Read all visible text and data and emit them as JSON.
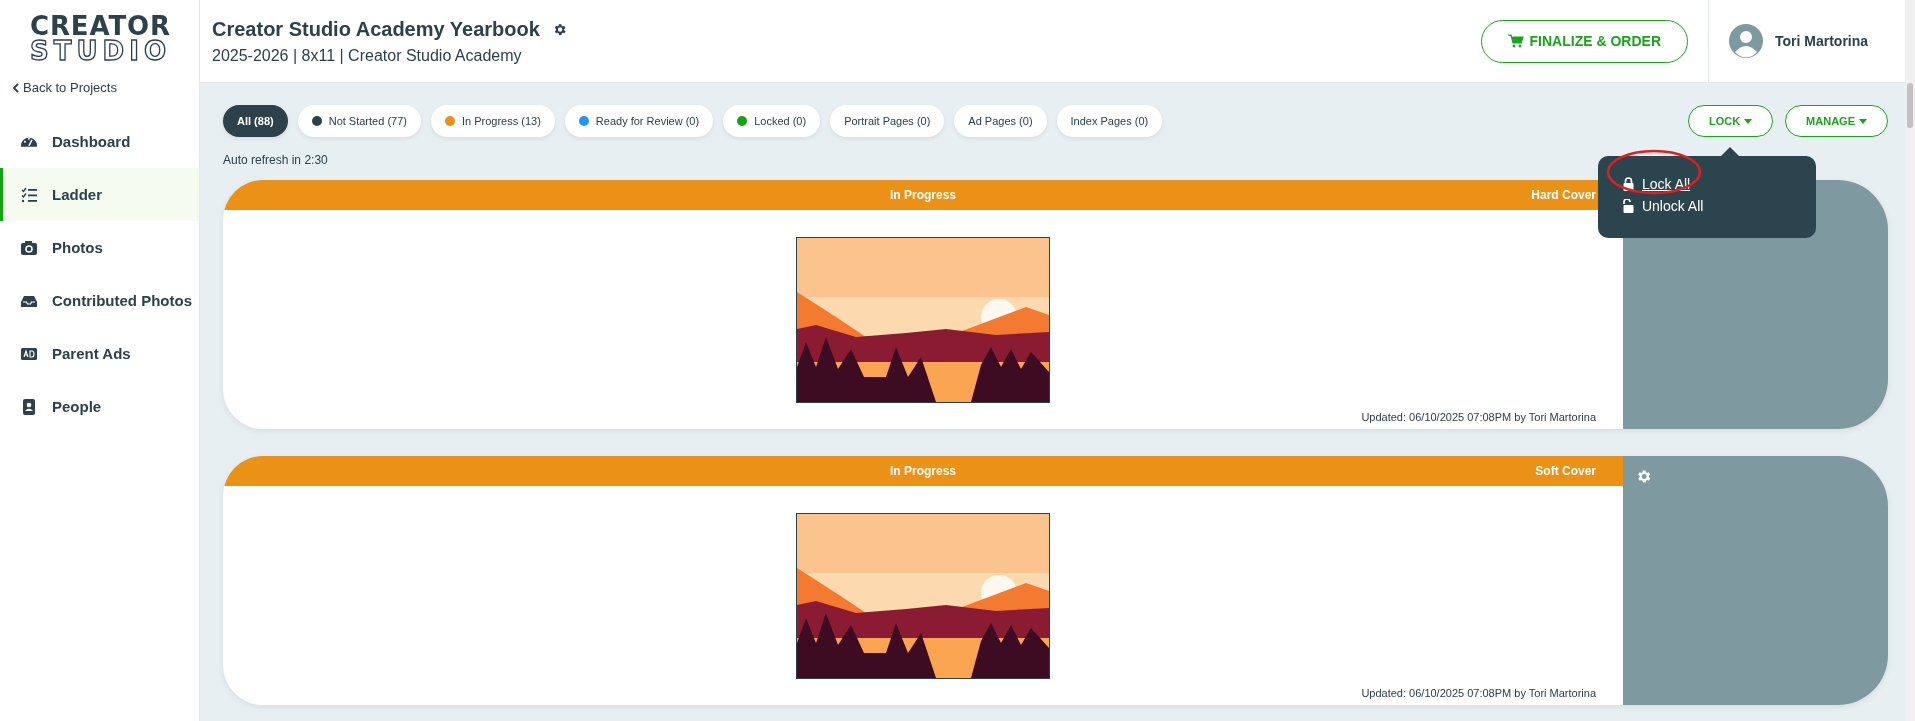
{
  "logo": {
    "line_1": "CREATOR",
    "line_2": "STUDIO"
  },
  "sidebar": {
    "back_link": "Back to Projects",
    "items": [
      {
        "label": "Dashboard",
        "selected": false
      },
      {
        "label": "Ladder",
        "selected": true
      },
      {
        "label": "Photos",
        "selected": false
      },
      {
        "label": "Contributed Photos",
        "selected": false
      },
      {
        "label": "Parent Ads",
        "selected": false
      },
      {
        "label": "People",
        "selected": false
      }
    ]
  },
  "header": {
    "title": "Creator Studio Academy Yearbook",
    "subtitle": "2025-2026 | 8x11 | Creator Studio Academy",
    "finalize_button": "FINALIZE & ORDER",
    "user_name": "Tori Martorina"
  },
  "filters": [
    {
      "label": "All (88)",
      "selected": true
    },
    {
      "label": "Not Started (77)",
      "selected": false,
      "color": "#2c414a"
    },
    {
      "label": "In Progress (13)",
      "selected": false,
      "color": "#ec9118"
    },
    {
      "label": "Ready for Review (0)",
      "selected": false,
      "color": "#2196f3"
    },
    {
      "label": "Locked (0)",
      "selected": false,
      "color": "#13a313"
    },
    {
      "label": "Portrait Pages (0)",
      "selected": false
    },
    {
      "label": "Ad Pages (0)",
      "selected": false
    },
    {
      "label": "Index Pages (0)",
      "selected": false
    }
  ],
  "auto_refresh": "Auto refresh in 2:30",
  "actions": {
    "lock_button": "LOCK",
    "manage_button": "MANAGE",
    "lock_menu": {
      "expanded": true,
      "items": [
        {
          "label": "Lock All",
          "kind": "lock",
          "selected": true
        },
        {
          "label": "Unlock All",
          "kind": "unlock",
          "selected": false
        }
      ]
    }
  },
  "pages": [
    {
      "status": "In Progress",
      "cover": "Hard Cover",
      "updated": "Updated: 06/10/2025 07:08PM by Tori Martorina"
    },
    {
      "status": "In Progress",
      "cover": "Soft Cover",
      "updated": "Updated: 06/10/2025 07:08PM by Tori Martorina"
    }
  ]
}
